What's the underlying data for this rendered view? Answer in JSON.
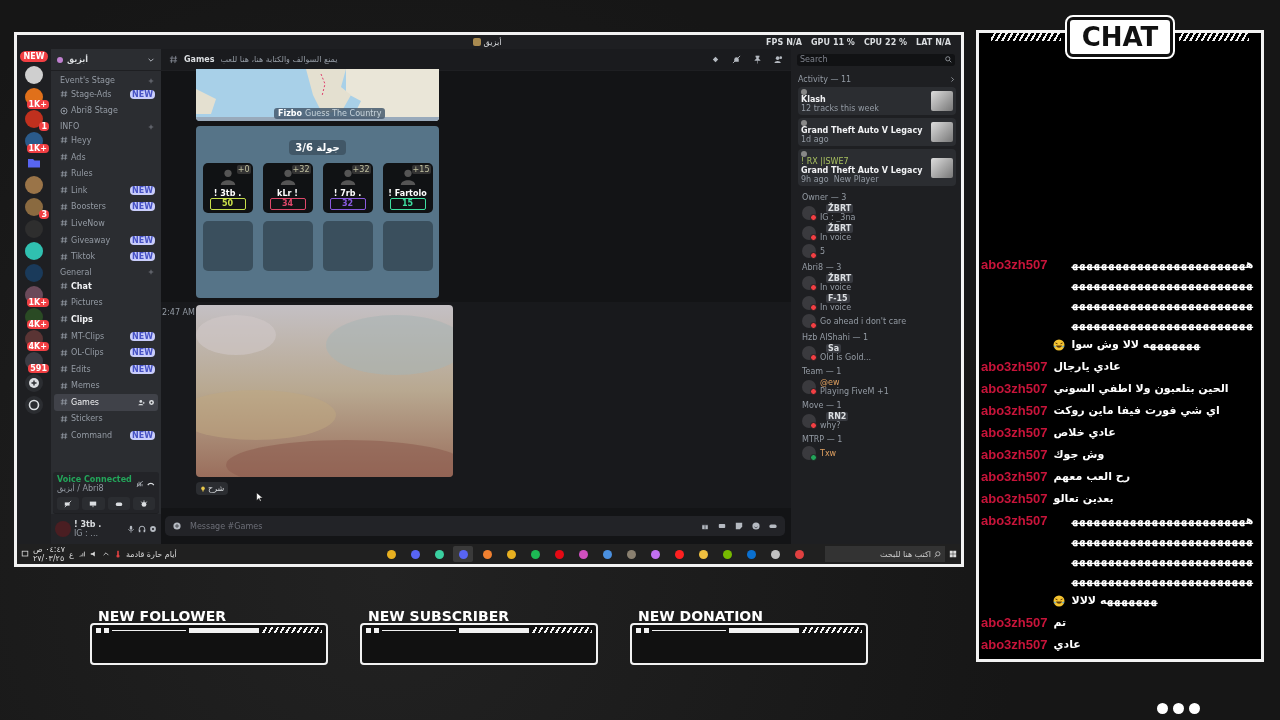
{
  "window": {
    "title": "أبزيق",
    "stats": [
      {
        "label": "FPS",
        "value": "N/A"
      },
      {
        "label": "GPU",
        "value": "11 %"
      },
      {
        "label": "CPU",
        "value": "22 %"
      },
      {
        "label": "LAT",
        "value": "N/A"
      }
    ]
  },
  "servers": [
    {
      "kind": "new",
      "label": "NEW"
    },
    {
      "kind": "avatar",
      "color": "#cfcfcf"
    },
    {
      "kind": "avatar",
      "color": "#e0701a",
      "badge": "1K+"
    },
    {
      "kind": "avatar",
      "color": "#c0301e",
      "badge": "1"
    },
    {
      "kind": "avatar",
      "color": "#2a5a8a",
      "badge": "1K+"
    },
    {
      "kind": "folder"
    },
    {
      "kind": "avatar",
      "color": "#9a7448"
    },
    {
      "kind": "avatar",
      "color": "#8a6a40",
      "badge": "3"
    },
    {
      "kind": "avatar",
      "color": "#2e2e2e"
    },
    {
      "kind": "avatar",
      "color": "#30c0b0"
    },
    {
      "kind": "avatar",
      "color": "#1a3a5a"
    },
    {
      "kind": "avatar",
      "color": "#6a4a5a",
      "badge": "1K+"
    },
    {
      "kind": "avatar",
      "color": "#2a4a24",
      "badge": "4K+"
    },
    {
      "kind": "avatar",
      "color": "#5a3434",
      "badge": "4K+"
    },
    {
      "kind": "avatar",
      "color": "#3c3c44",
      "badge": "591"
    },
    {
      "kind": "add"
    },
    {
      "kind": "discover"
    }
  ],
  "server_name": "أبزيق",
  "channel_groups": [
    {
      "name": "Event's Stage",
      "channels": [
        {
          "name": "Stage-Ads",
          "kind": "text",
          "badge": "NEW",
          "unread": false,
          "selected": false
        },
        {
          "name": "Abri8 Stage",
          "kind": "stage",
          "unread": false,
          "selected": false
        }
      ]
    },
    {
      "name": "INFO",
      "channels": [
        {
          "name": "Heyy",
          "kind": "text",
          "unread": false,
          "selected": false
        },
        {
          "name": "Ads",
          "kind": "text",
          "unread": false,
          "selected": false
        },
        {
          "name": "Rules",
          "kind": "text",
          "unread": false,
          "selected": false
        },
        {
          "name": "Link",
          "kind": "text",
          "badge": "NEW",
          "unread": false,
          "selected": false
        },
        {
          "name": "Boosters",
          "kind": "text",
          "badge": "NEW",
          "unread": false,
          "selected": false
        },
        {
          "name": "LiveNow",
          "kind": "text",
          "unread": false,
          "selected": false
        },
        {
          "name": "Giveaway",
          "kind": "text",
          "badge": "NEW",
          "unread": false,
          "selected": false
        },
        {
          "name": "Tiktok",
          "kind": "text",
          "badge": "NEW",
          "unread": false,
          "selected": false
        }
      ]
    },
    {
      "name": "General",
      "channels": [
        {
          "name": "Chat",
          "kind": "text",
          "unread": true,
          "selected": false
        },
        {
          "name": "Pictures",
          "kind": "text",
          "unread": false,
          "selected": false
        },
        {
          "name": "Clips",
          "kind": "text",
          "unread": true,
          "selected": false
        },
        {
          "name": "MT-Clips",
          "kind": "text",
          "badge": "NEW",
          "unread": false,
          "selected": false
        },
        {
          "name": "OL-Clips",
          "kind": "text",
          "badge": "NEW",
          "unread": false,
          "selected": false
        },
        {
          "name": "Edits",
          "kind": "text",
          "badge": "NEW",
          "unread": false,
          "selected": false
        },
        {
          "name": "Memes",
          "kind": "text",
          "unread": false,
          "selected": false
        },
        {
          "name": "Games",
          "kind": "text",
          "unread": false,
          "selected": true
        },
        {
          "name": "Stickers",
          "kind": "text",
          "unread": false,
          "selected": false
        },
        {
          "name": "Command",
          "kind": "text",
          "badge": "NEW",
          "unread": false,
          "selected": false
        }
      ]
    }
  ],
  "voice": {
    "status": "Voice Connected",
    "location": "أبزيق / Abri8"
  },
  "user": {
    "name": "! 3tb .",
    "status": "IG : ..."
  },
  "channel_header": {
    "name": "Games",
    "topic": "يمنع السوالف والكتابة هنا، هنا للعب"
  },
  "messages": {
    "map": {
      "brand": "Fizbo",
      "tagline": "Guess The Country"
    },
    "game": {
      "round": "جولة 3/6",
      "players": [
        {
          "name": "! 3tb .",
          "score": "50",
          "delta": "+0",
          "color": "#c8e04a"
        },
        {
          "name": "kLr !",
          "score": "34",
          "delta": "+32",
          "color": "#e0486a"
        },
        {
          "name": "! 7rb .",
          "score": "32",
          "delta": "+32",
          "color": "#8a5ae0"
        },
        {
          "name": "! Fartolo",
          "score": "15",
          "delta": "+15",
          "color": "#3ee0a0"
        }
      ]
    },
    "timestamp": "2:47 AM",
    "button": "شرح"
  },
  "composer": {
    "placeholder": "Message #Games"
  },
  "members": {
    "search": {
      "placeholder": "Search"
    },
    "activity_title": "Activity — 11",
    "activities": [
      {
        "title": "Klash",
        "detail": "12 tracks this week"
      },
      {
        "title": "Grand Theft Auto V Legacy",
        "detail": "1d ago"
      },
      {
        "user": "! RX |ISWE7",
        "title": "Grand Theft Auto V Legacy",
        "detail": "9h ago",
        "extra": "New Player"
      }
    ],
    "groups": [
      {
        "name": "Owner — 3",
        "members": [
          {
            "tag": "ŽBRT",
            "status_text": "IG : _3na",
            "color": "#f23f43"
          },
          {
            "tag": "ŽBRT",
            "status_text": "In voice",
            "color": "#f23f43"
          },
          {
            "status_text": "5",
            "color": "#f23f43"
          }
        ]
      },
      {
        "name": "Abri8 — 3",
        "members": [
          {
            "tag": "ŽBRT",
            "status_text": "In voice",
            "color": "#f23f43"
          },
          {
            "tag": "F-15",
            "status_text": "In voice",
            "color": "#f23f43"
          },
          {
            "status_text": "Go ahead i don't care",
            "color": "#f23f43"
          }
        ]
      },
      {
        "name": "Hzb AlShahi — 1",
        "members": [
          {
            "tag": "Sa",
            "status_text": "Old is Gold...",
            "color": "#f23f43"
          }
        ]
      },
      {
        "name": "Team — 1",
        "members": [
          {
            "name": "@ew",
            "status_text": "Playing FiveM +1",
            "color": "#f23f43"
          }
        ]
      },
      {
        "name": "Move — 1",
        "members": [
          {
            "tag": "RN2",
            "status_text": "why?",
            "color": "#f23f43"
          }
        ]
      },
      {
        "name": "MTRP — 1",
        "members": [
          {
            "name": "Txw",
            "color": "#23a55a"
          }
        ]
      }
    ]
  },
  "taskbar": {
    "search": {
      "placeholder": "اكتب هنا للبحث"
    },
    "apps": [
      {
        "color": "#e8b020",
        "selected": false
      },
      {
        "color": "#5865f2",
        "selected": false
      },
      {
        "color": "#3ad0a0",
        "selected": false
      },
      {
        "color": "#5865f2",
        "selected": true
      },
      {
        "color": "#f08030",
        "selected": false
      },
      {
        "color": "#e8b020",
        "selected": false
      },
      {
        "color": "#1db954",
        "selected": false
      },
      {
        "color": "#e50914",
        "selected": false
      },
      {
        "color": "#d050c0",
        "selected": false
      },
      {
        "color": "#4a90e0",
        "selected": false
      },
      {
        "color": "#8a8070",
        "selected": false
      },
      {
        "color": "#c070f0",
        "selected": false
      },
      {
        "color": "#ff2020",
        "selected": false
      },
      {
        "color": "#f0c040",
        "selected": false
      },
      {
        "color": "#76b900",
        "selected": false
      },
      {
        "color": "#0a70d0",
        "selected": false
      },
      {
        "color": "#c0c0c0",
        "selected": false
      },
      {
        "color": "#e04040",
        "selected": false
      }
    ],
    "weather": "أيام حارة قادمة",
    "lang": "ع",
    "time": "٠٤:٤٧ ص",
    "date": "٢٧/٠٣/٢٥"
  },
  "chat": {
    "title": "CHAT",
    "messages": [
      {
        "user": "abo3zh507",
        "text": "هههههههههههههههههههههههههههههههههههههههههههههههههههههههههههههههههههههههههههههههههههههههههههههههههههههههههههه لالا وش سوا",
        "emoji": true
      },
      {
        "user": "abo3zh507",
        "text": "عادي يارجال",
        "emoji": false
      },
      {
        "user": "abo3zh507",
        "text": "الحين بتلعبون ولا اطفي السوني",
        "emoji": false
      },
      {
        "user": "abo3zh507",
        "text": "اي شي فورت فيفا ماين روكت",
        "emoji": false
      },
      {
        "user": "abo3zh507",
        "text": "عادي خلاص",
        "emoji": false
      },
      {
        "user": "abo3zh507",
        "text": "وش جوك",
        "emoji": false
      },
      {
        "user": "abo3zh507",
        "text": "رح العب معهم",
        "emoji": false
      },
      {
        "user": "abo3zh507",
        "text": "بعدين تعالو",
        "emoji": false
      },
      {
        "user": "abo3zh507",
        "text": "هههههههههههههههههههههههههههههههههههههههههههههههههههههههههههههههههههههههههههههههههههههههههههههههههههههههههههه لالالا",
        "emoji": true
      },
      {
        "user": "abo3zh507",
        "text": "تم",
        "emoji": false
      },
      {
        "user": "abo3zh507",
        "text": "عادي",
        "emoji": false
      }
    ]
  },
  "alerts": [
    {
      "title": "NEW FOLLOWER"
    },
    {
      "title": "NEW SUBSCRIBER"
    },
    {
      "title": "NEW DONATION"
    }
  ]
}
